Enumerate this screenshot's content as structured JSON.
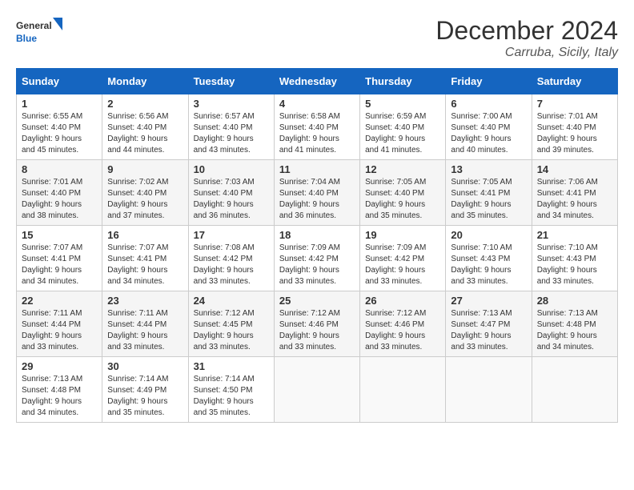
{
  "logo": {
    "general": "General",
    "blue": "Blue"
  },
  "title": {
    "month_year": "December 2024",
    "location": "Carruba, Sicily, Italy"
  },
  "calendar": {
    "headers": [
      "Sunday",
      "Monday",
      "Tuesday",
      "Wednesday",
      "Thursday",
      "Friday",
      "Saturday"
    ],
    "weeks": [
      [
        {
          "day": "1",
          "sunrise": "6:55 AM",
          "sunset": "4:40 PM",
          "daylight": "9 hours and 45 minutes."
        },
        {
          "day": "2",
          "sunrise": "6:56 AM",
          "sunset": "4:40 PM",
          "daylight": "9 hours and 44 minutes."
        },
        {
          "day": "3",
          "sunrise": "6:57 AM",
          "sunset": "4:40 PM",
          "daylight": "9 hours and 43 minutes."
        },
        {
          "day": "4",
          "sunrise": "6:58 AM",
          "sunset": "4:40 PM",
          "daylight": "9 hours and 41 minutes."
        },
        {
          "day": "5",
          "sunrise": "6:59 AM",
          "sunset": "4:40 PM",
          "daylight": "9 hours and 41 minutes."
        },
        {
          "day": "6",
          "sunrise": "7:00 AM",
          "sunset": "4:40 PM",
          "daylight": "9 hours and 40 minutes."
        },
        {
          "day": "7",
          "sunrise": "7:01 AM",
          "sunset": "4:40 PM",
          "daylight": "9 hours and 39 minutes."
        }
      ],
      [
        {
          "day": "8",
          "sunrise": "7:01 AM",
          "sunset": "4:40 PM",
          "daylight": "9 hours and 38 minutes."
        },
        {
          "day": "9",
          "sunrise": "7:02 AM",
          "sunset": "4:40 PM",
          "daylight": "9 hours and 37 minutes."
        },
        {
          "day": "10",
          "sunrise": "7:03 AM",
          "sunset": "4:40 PM",
          "daylight": "9 hours and 36 minutes."
        },
        {
          "day": "11",
          "sunrise": "7:04 AM",
          "sunset": "4:40 PM",
          "daylight": "9 hours and 36 minutes."
        },
        {
          "day": "12",
          "sunrise": "7:05 AM",
          "sunset": "4:40 PM",
          "daylight": "9 hours and 35 minutes."
        },
        {
          "day": "13",
          "sunrise": "7:05 AM",
          "sunset": "4:41 PM",
          "daylight": "9 hours and 35 minutes."
        },
        {
          "day": "14",
          "sunrise": "7:06 AM",
          "sunset": "4:41 PM",
          "daylight": "9 hours and 34 minutes."
        }
      ],
      [
        {
          "day": "15",
          "sunrise": "7:07 AM",
          "sunset": "4:41 PM",
          "daylight": "9 hours and 34 minutes."
        },
        {
          "day": "16",
          "sunrise": "7:07 AM",
          "sunset": "4:41 PM",
          "daylight": "9 hours and 34 minutes."
        },
        {
          "day": "17",
          "sunrise": "7:08 AM",
          "sunset": "4:42 PM",
          "daylight": "9 hours and 33 minutes."
        },
        {
          "day": "18",
          "sunrise": "7:09 AM",
          "sunset": "4:42 PM",
          "daylight": "9 hours and 33 minutes."
        },
        {
          "day": "19",
          "sunrise": "7:09 AM",
          "sunset": "4:42 PM",
          "daylight": "9 hours and 33 minutes."
        },
        {
          "day": "20",
          "sunrise": "7:10 AM",
          "sunset": "4:43 PM",
          "daylight": "9 hours and 33 minutes."
        },
        {
          "day": "21",
          "sunrise": "7:10 AM",
          "sunset": "4:43 PM",
          "daylight": "9 hours and 33 minutes."
        }
      ],
      [
        {
          "day": "22",
          "sunrise": "7:11 AM",
          "sunset": "4:44 PM",
          "daylight": "9 hours and 33 minutes."
        },
        {
          "day": "23",
          "sunrise": "7:11 AM",
          "sunset": "4:44 PM",
          "daylight": "9 hours and 33 minutes."
        },
        {
          "day": "24",
          "sunrise": "7:12 AM",
          "sunset": "4:45 PM",
          "daylight": "9 hours and 33 minutes."
        },
        {
          "day": "25",
          "sunrise": "7:12 AM",
          "sunset": "4:46 PM",
          "daylight": "9 hours and 33 minutes."
        },
        {
          "day": "26",
          "sunrise": "7:12 AM",
          "sunset": "4:46 PM",
          "daylight": "9 hours and 33 minutes."
        },
        {
          "day": "27",
          "sunrise": "7:13 AM",
          "sunset": "4:47 PM",
          "daylight": "9 hours and 33 minutes."
        },
        {
          "day": "28",
          "sunrise": "7:13 AM",
          "sunset": "4:48 PM",
          "daylight": "9 hours and 34 minutes."
        }
      ],
      [
        {
          "day": "29",
          "sunrise": "7:13 AM",
          "sunset": "4:48 PM",
          "daylight": "9 hours and 34 minutes."
        },
        {
          "day": "30",
          "sunrise": "7:14 AM",
          "sunset": "4:49 PM",
          "daylight": "9 hours and 35 minutes."
        },
        {
          "day": "31",
          "sunrise": "7:14 AM",
          "sunset": "4:50 PM",
          "daylight": "9 hours and 35 minutes."
        },
        null,
        null,
        null,
        null
      ]
    ]
  }
}
